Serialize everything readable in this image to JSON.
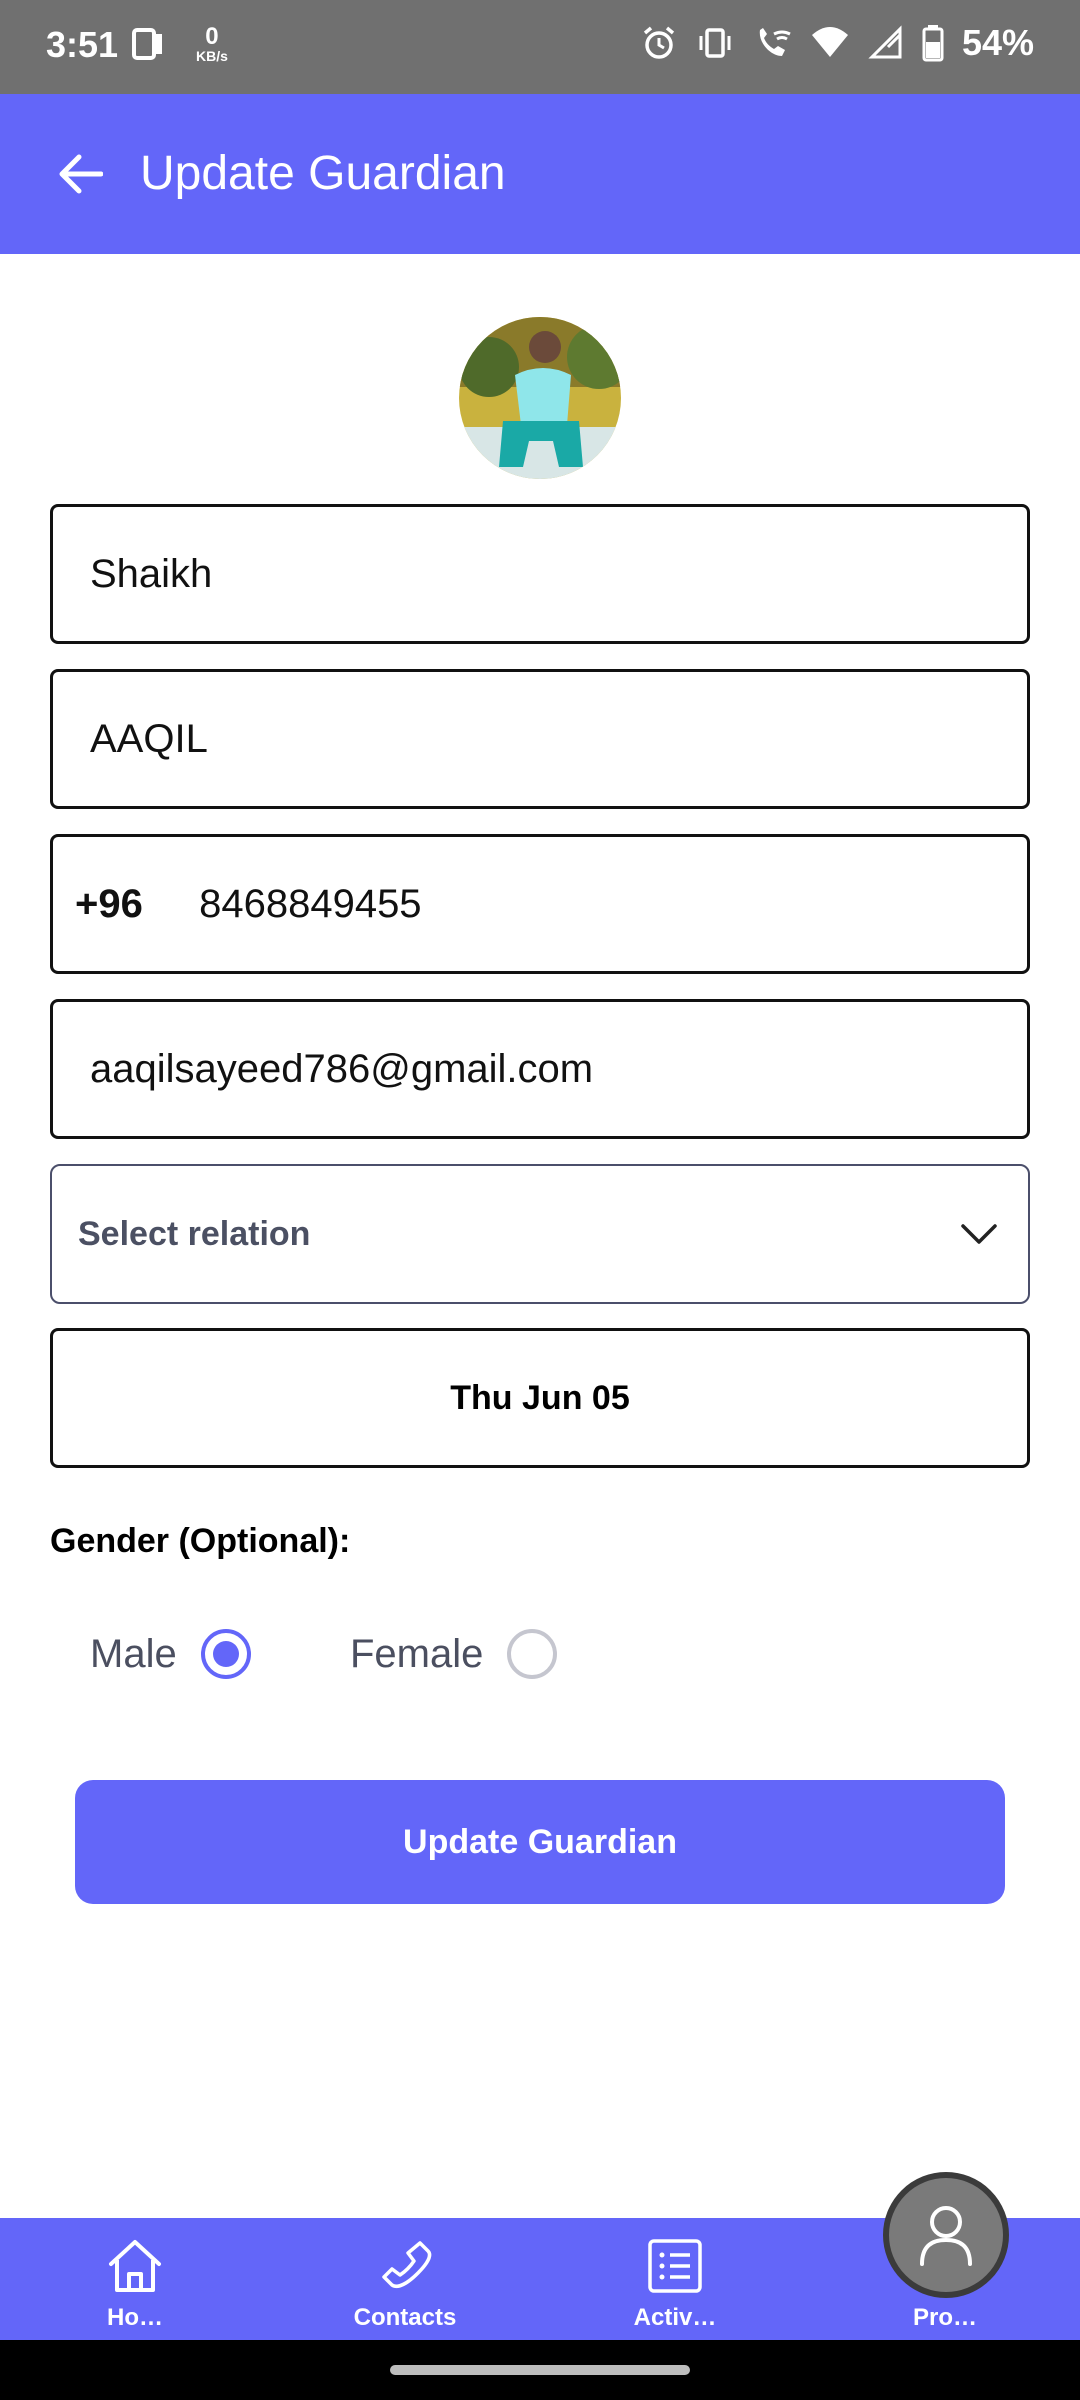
{
  "status_bar": {
    "time": "3:51",
    "net_speed_value": "0",
    "net_speed_unit": "KB/s",
    "battery": "54%"
  },
  "app_bar": {
    "title": "Update Guardian"
  },
  "form": {
    "last_name": "Shaikh",
    "first_name": "AAQIL",
    "phone_code": "+96",
    "phone": "8468849455",
    "email": "aaqilsayeed786@gmail.com",
    "relation_placeholder": "Select relation",
    "date": "Thu Jun 05",
    "gender_label": "Gender (Optional):",
    "gender_options": [
      {
        "label": "Male",
        "selected": true
      },
      {
        "label": "Female",
        "selected": false
      }
    ],
    "submit_label": "Update Guardian"
  },
  "bottom_nav": {
    "items": [
      {
        "label": "Ho…",
        "icon": "home-icon"
      },
      {
        "label": "Contacts",
        "icon": "phone-icon"
      },
      {
        "label": "Activ…",
        "icon": "list-icon"
      },
      {
        "label": "Pro…",
        "icon": "user-icon"
      }
    ]
  },
  "colors": {
    "primary": "#6366f9",
    "status_bar": "#707070"
  }
}
